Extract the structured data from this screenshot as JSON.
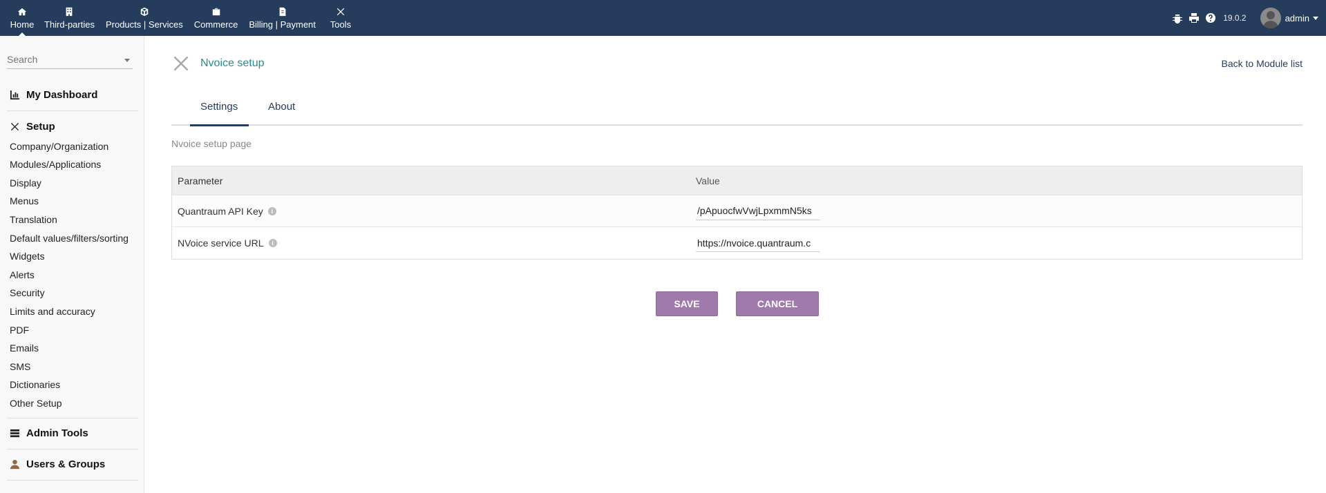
{
  "topnav": {
    "items": [
      {
        "label": "Home",
        "icon": "home-icon"
      },
      {
        "label": "Third-parties",
        "icon": "building-icon"
      },
      {
        "label": "Products | Services",
        "icon": "cube-icon"
      },
      {
        "label": "Commerce",
        "icon": "briefcase-icon"
      },
      {
        "label": "Billing | Payment",
        "icon": "file-invoice-icon"
      },
      {
        "label": "Tools",
        "icon": "tools-icon"
      }
    ],
    "version": "19.0.2",
    "user": "admin"
  },
  "sidebar": {
    "search_placeholder": "Search",
    "dashboard": "My Dashboard",
    "setup": "Setup",
    "setup_items": [
      "Company/Organization",
      "Modules/Applications",
      "Display",
      "Menus",
      "Translation",
      "Default values/filters/sorting",
      "Widgets",
      "Alerts",
      "Security",
      "Limits and accuracy",
      "PDF",
      "Emails",
      "SMS",
      "Dictionaries",
      "Other Setup"
    ],
    "admin_tools": "Admin Tools",
    "users_groups": "Users & Groups"
  },
  "main": {
    "title": "Nvoice setup",
    "back_link": "Back to Module list",
    "tabs": [
      "Settings",
      "About"
    ],
    "description": "Nvoice setup page",
    "table": {
      "headers": [
        "Parameter",
        "Value"
      ],
      "rows": [
        {
          "param": "Quantraum API Key",
          "value": "/pApuocfwVwjLpxmmN5ks"
        },
        {
          "param": "NVoice service URL",
          "value": "https://nvoice.quantraum.c"
        }
      ]
    },
    "save_label": "SAVE",
    "cancel_label": "CANCEL"
  },
  "colors": {
    "topbar": "#263c5c",
    "accent_title": "#2a8a8a",
    "button": "#a07aad"
  }
}
